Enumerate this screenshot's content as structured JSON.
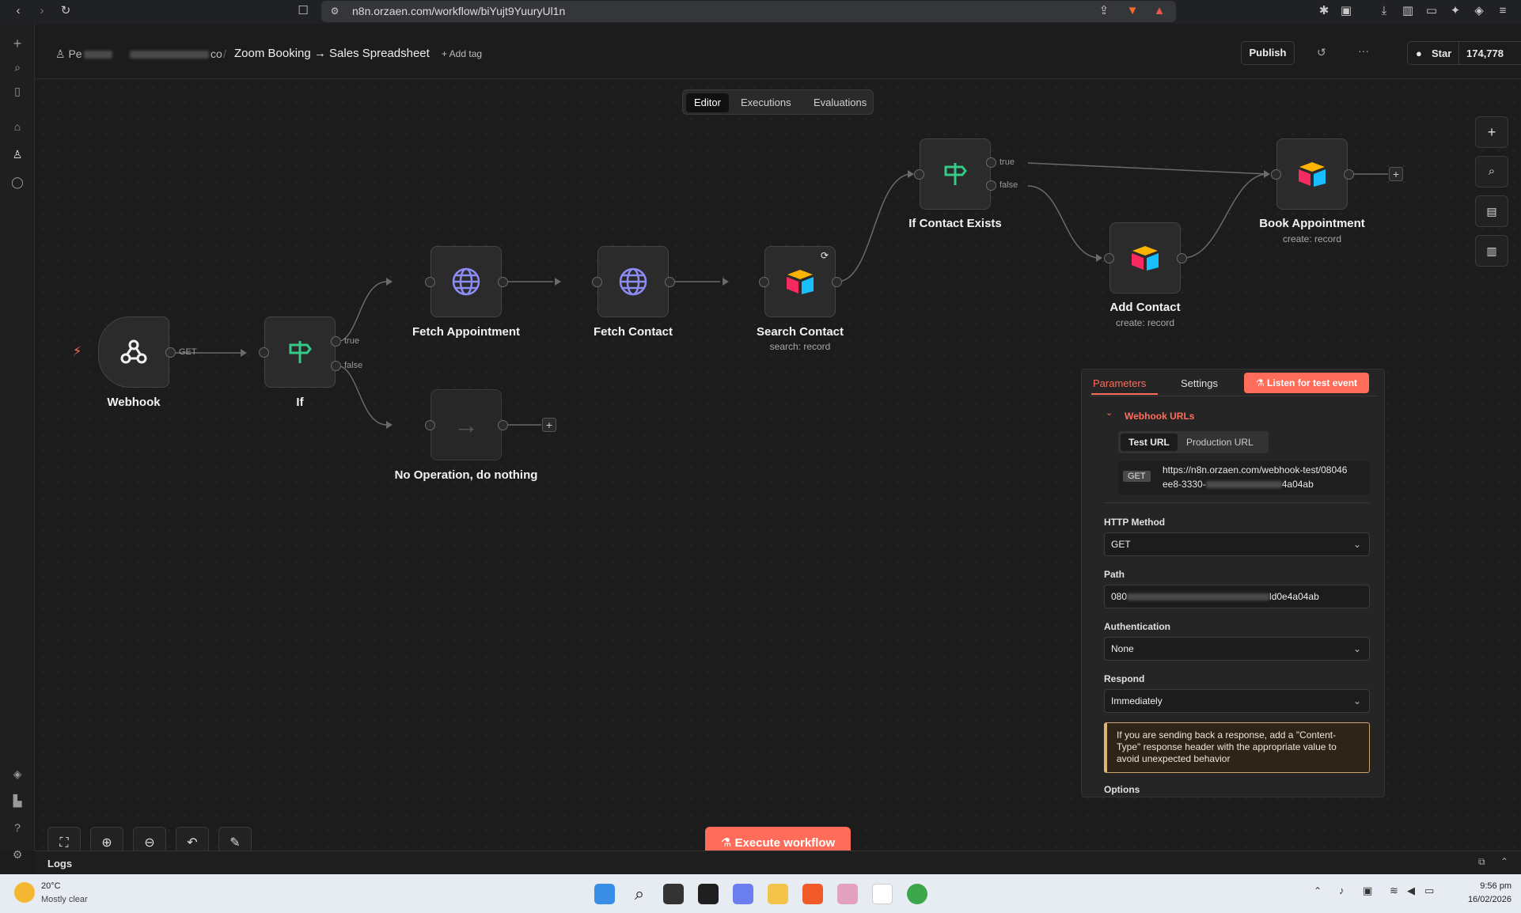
{
  "browser": {
    "url": "n8n.orzaen.com/workflow/biYujt9YuuryUl1n"
  },
  "header": {
    "project": "Pe",
    "folder": "co",
    "workflow_name": "Zoom Booking → Sales Spreadsheet",
    "add_tag": "+ Add tag",
    "publish": "Publish",
    "star": "Star",
    "star_count": "174,778"
  },
  "tabs": [
    "Editor",
    "Executions",
    "Evaluations"
  ],
  "nodes": {
    "webhook": {
      "label": "Webhook",
      "port": "GET"
    },
    "if": {
      "label": "If",
      "true": "true",
      "false": "false"
    },
    "fetch_appointment": {
      "label": "Fetch Appointment"
    },
    "fetch_contact": {
      "label": "Fetch Contact"
    },
    "search_contact": {
      "label": "Search Contact",
      "sub": "search: record"
    },
    "no_op": {
      "label": "No Operation, do nothing"
    },
    "if_contact_exists": {
      "label": "If Contact Exists",
      "true": "true",
      "false": "false"
    },
    "add_contact": {
      "label": "Add Contact",
      "sub": "create: record"
    },
    "book_appointment": {
      "label": "Book Appointment",
      "sub": "create: record"
    }
  },
  "panel": {
    "tab_parameters": "Parameters",
    "tab_settings": "Settings",
    "listen_button": "Listen for test event",
    "section": "Webhook URLs",
    "url_tab_test": "Test URL",
    "url_tab_prod": "Production URL",
    "method_badge": "GET",
    "url_line1": "https://n8n.orzaen.com/webhook-test/08046",
    "url_line2_start": "ee8-3330-",
    "url_line2_end": "4a04ab",
    "http_method_label": "HTTP Method",
    "http_method_value": "GET",
    "path_label": "Path",
    "path_start": "080",
    "path_end": "ld0e4a04ab",
    "auth_label": "Authentication",
    "auth_value": "None",
    "respond_label": "Respond",
    "respond_value": "Immediately",
    "notice": "If you are sending back a response, add a \"Content-Type\" response header with the appropriate value to avoid unexpected behavior",
    "options_label": "Options"
  },
  "execute_button": "Execute workflow",
  "logs_label": "Logs",
  "taskbar": {
    "temp": "20°C",
    "weather": "Mostly clear",
    "time": "9:56 pm",
    "date": "16/02/2026"
  },
  "colors": {
    "accent": "#ff6d5a",
    "green_icon": "#36c98a",
    "globe": "#8c8cf5"
  }
}
